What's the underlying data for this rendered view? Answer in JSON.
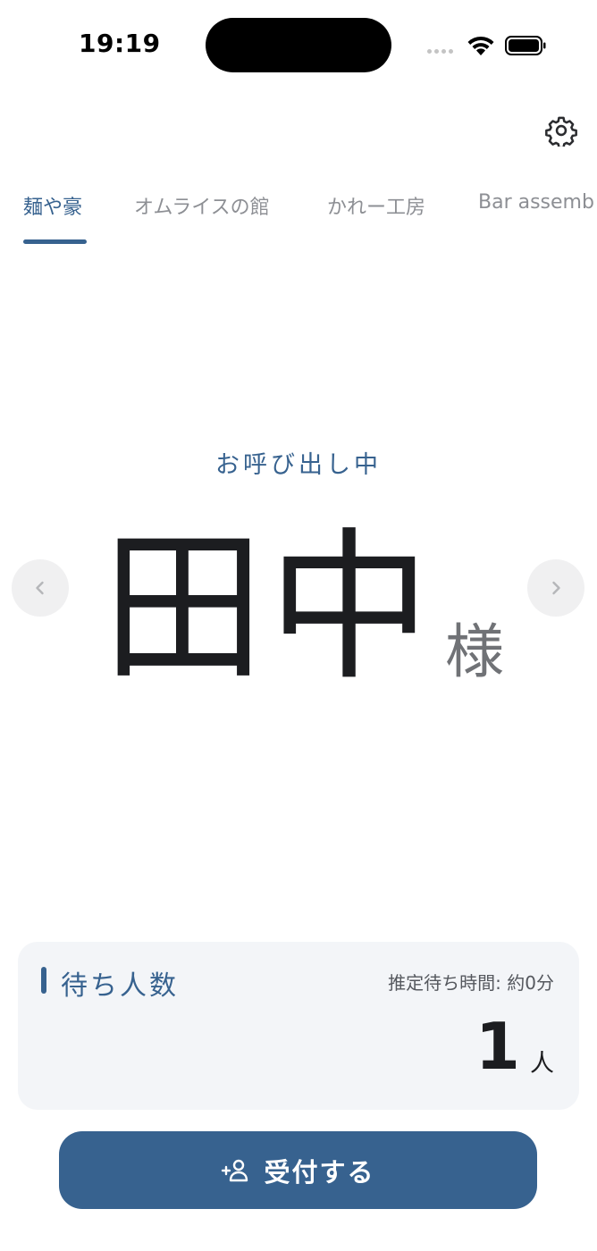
{
  "status_bar": {
    "time": "19:19"
  },
  "header": {
    "settings_icon": "gear-icon"
  },
  "tabs": [
    {
      "label": "麺や豪",
      "active": true
    },
    {
      "label": "オムライスの館",
      "active": false
    },
    {
      "label": "かれー工房",
      "active": false
    },
    {
      "label": "Bar assemb",
      "active": false
    }
  ],
  "calling": {
    "label": "お呼び出し中",
    "name": "田中",
    "honorific": "様",
    "prev_icon": "chevron-left-icon",
    "next_icon": "chevron-right-icon"
  },
  "waiting": {
    "title": "待ち人数",
    "estimate": "推定待ち時間: 約0分",
    "count": "1",
    "unit": "人"
  },
  "register": {
    "label": "受付する",
    "icon": "add-person-icon"
  },
  "colors": {
    "accent": "#37628f",
    "text": "#1c1d20",
    "muted": "#8d8f94",
    "card_bg": "#f3f5f8"
  }
}
